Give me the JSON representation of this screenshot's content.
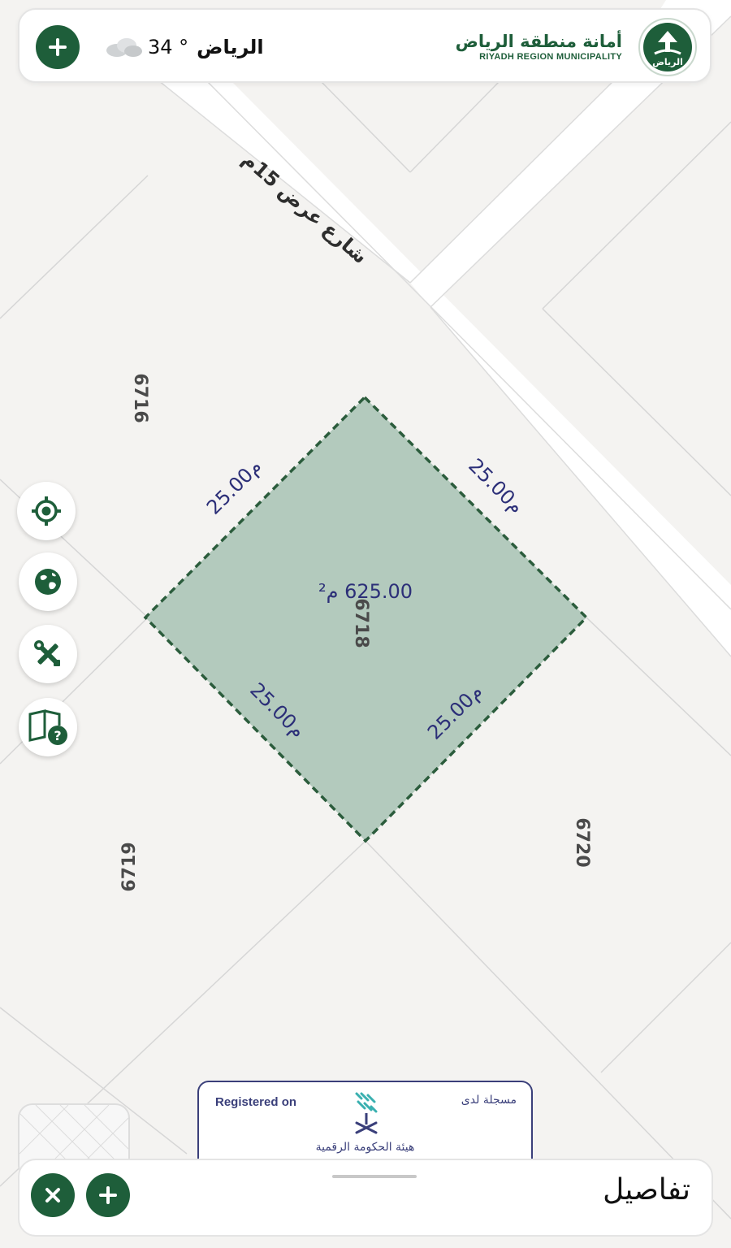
{
  "header": {
    "weather": {
      "temperature": "34 °",
      "city": "الرياض",
      "icon": "cloud-icon"
    },
    "logo": {
      "arabic_name": "أمانة منطقة الرياض",
      "english_name": "RIYADH REGION MUNICIPALITY",
      "seal_text": "الرياض"
    }
  },
  "map": {
    "street_label": "شارع عرض 15م",
    "parcels": {
      "main": "6718",
      "north_west": "6716",
      "south_west": "6719",
      "south_east": "6720"
    },
    "selected_parcel": {
      "area_label": "625.00 م²",
      "edges": [
        "25.00م",
        "25.00م",
        "25.00م",
        "25.00م"
      ]
    }
  },
  "tools": [
    {
      "name": "locate-me",
      "icon": "crosshair-icon"
    },
    {
      "name": "basemap",
      "icon": "globe-icon"
    },
    {
      "name": "tools",
      "icon": "tools-icon"
    },
    {
      "name": "help",
      "icon": "guide-help-icon"
    }
  ],
  "registered": {
    "english": "Registered on",
    "arabic": "مسجلة لدى",
    "organization": "هيئة الحكومة الرقمية"
  },
  "bottom_panel": {
    "title": "تفاصيل"
  },
  "colors": {
    "brand_green": "#1e5e3a",
    "parcel_fill": "#b3cabd",
    "parcel_border": "#2b5c3c",
    "label_navy": "#2c2f78",
    "registration_navy": "#3a3f7a"
  }
}
